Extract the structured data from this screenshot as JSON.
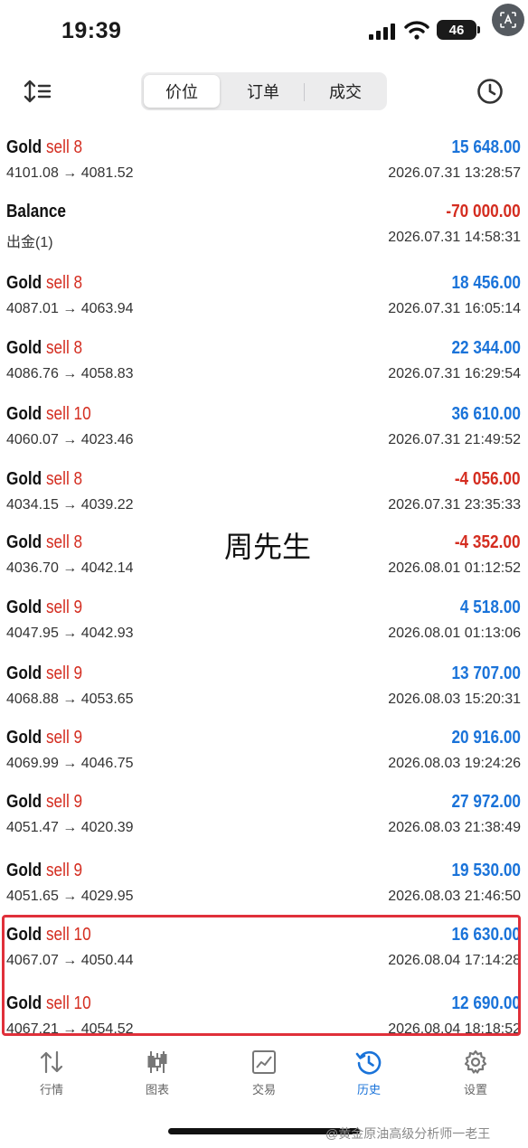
{
  "status_bar": {
    "time": "19:39",
    "battery": "46"
  },
  "segments": [
    {
      "label": "价位",
      "active": true
    },
    {
      "label": "订单",
      "active": false
    },
    {
      "label": "成交",
      "active": false
    }
  ],
  "rows": [
    {
      "symbol": "Gold",
      "side": "sell 8",
      "profit": "15 648.00",
      "prices": "4101.08 → 4081.52",
      "time": "2026.07.31 13:28:57"
    },
    {
      "symbol": "Balance",
      "side": "",
      "profit": "-70 000.00",
      "prices": "出金(1)",
      "time": "2026.07.31 14:58:31"
    },
    {
      "symbol": "Gold",
      "side": "sell 8",
      "profit": "18 456.00",
      "prices": "4087.01 → 4063.94",
      "time": "2026.07.31 16:05:14"
    },
    {
      "symbol": "Gold",
      "side": "sell 8",
      "profit": "22 344.00",
      "prices": "4086.76 → 4058.83",
      "time": "2026.07.31 16:29:54"
    },
    {
      "symbol": "Gold",
      "side": "sell 10",
      "profit": "36 610.00",
      "prices": "4060.07 → 4023.46",
      "time": "2026.07.31 21:49:52"
    },
    {
      "symbol": "Gold",
      "side": "sell 8",
      "profit": "-4 056.00",
      "prices": "4034.15 → 4039.22",
      "time": "2026.07.31 23:35:33"
    },
    {
      "symbol": "Gold",
      "side": "sell 8",
      "profit": "-4 352.00",
      "prices": "4036.70 → 4042.14",
      "time": "2026.08.01 01:12:52"
    },
    {
      "symbol": "Gold",
      "side": "sell 9",
      "profit": "4 518.00",
      "prices": "4047.95 → 4042.93",
      "time": "2026.08.01 01:13:06"
    },
    {
      "symbol": "Gold",
      "side": "sell 9",
      "profit": "13 707.00",
      "prices": "4068.88 → 4053.65",
      "time": "2026.08.03 15:20:31"
    },
    {
      "symbol": "Gold",
      "side": "sell 9",
      "profit": "20 916.00",
      "prices": "4069.99 → 4046.75",
      "time": "2026.08.03 19:24:26"
    },
    {
      "symbol": "Gold",
      "side": "sell 9",
      "profit": "27 972.00",
      "prices": "4051.47 → 4020.39",
      "time": "2026.08.03 21:38:49"
    },
    {
      "symbol": "Gold",
      "side": "sell 9",
      "profit": "19 530.00",
      "prices": "4051.65 → 4029.95",
      "time": "2026.08.03 21:46:50"
    },
    {
      "symbol": "Gold",
      "side": "sell 10",
      "profit": "16 630.00",
      "prices": "4067.07 → 4050.44",
      "time": "2026.08.04 17:14:28"
    },
    {
      "symbol": "Gold",
      "side": "sell 10",
      "profit": "12 690.00",
      "prices": "4067.21 → 4054.52",
      "time": "2026.08.04 18:18:52"
    }
  ],
  "overlay_name": "周先生",
  "tabs": [
    {
      "label": "行情",
      "icon": "arrows-updown-icon",
      "active": false
    },
    {
      "label": "图表",
      "icon": "candlestick-icon",
      "active": false
    },
    {
      "label": "交易",
      "icon": "trade-chart-icon",
      "active": false
    },
    {
      "label": "历史",
      "icon": "history-clock-icon",
      "active": true
    },
    {
      "label": "设置",
      "icon": "gear-icon",
      "active": false
    }
  ],
  "weibo_watermark": "@黄金原油高级分析师一老王",
  "colors": {
    "profit_positive": "#1a73d9",
    "profit_negative": "#d42d20",
    "sell": "#d42d20",
    "active_tab": "#1a73d9",
    "highlight_box": "#e0303a"
  }
}
